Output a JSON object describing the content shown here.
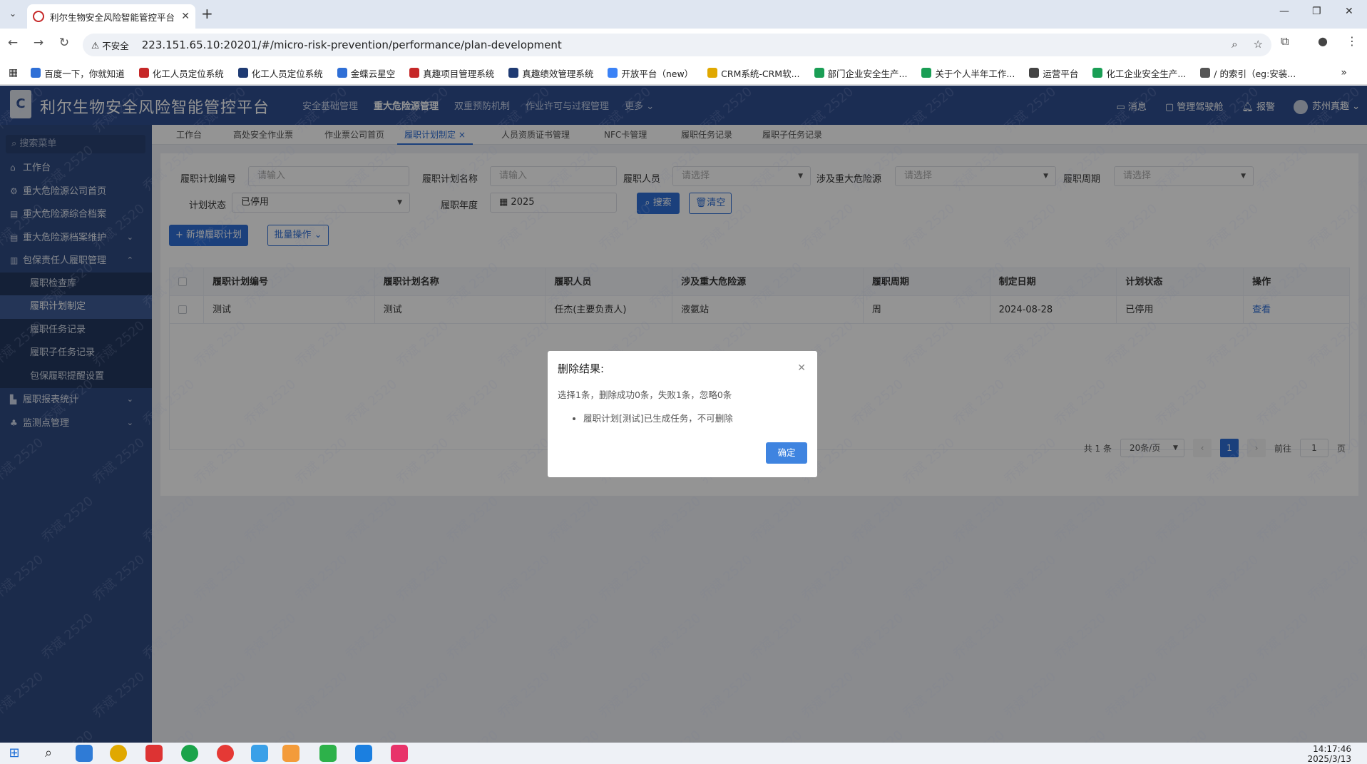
{
  "browser": {
    "tab_title": "利尔生物安全风险智能管控平台",
    "security_label": "不安全",
    "url": "223.151.65.10:20201/#/micro-risk-prevention/performance/plan-development",
    "bookmarks": [
      {
        "label": "百度一下，你就知道",
        "color": "#2f6fd6"
      },
      {
        "label": "化工人员定位系统",
        "color": "#c62828"
      },
      {
        "label": "化工人员定位系统",
        "color": "#1f3b73"
      },
      {
        "label": "金蝶云星空",
        "color": "#2f6fd6"
      },
      {
        "label": "真趣项目管理系统",
        "color": "#c62828"
      },
      {
        "label": "真趣绩效管理系统",
        "color": "#1f3b73"
      },
      {
        "label": "开放平台（new）",
        "color": "#3b82f6"
      },
      {
        "label": "CRM系统-CRM软...",
        "color": "#e0a800"
      },
      {
        "label": "部门企业安全生产...",
        "color": "#1a9e55"
      },
      {
        "label": "关于个人半年工作...",
        "color": "#1a9e55"
      },
      {
        "label": "运营平台",
        "color": "#444"
      },
      {
        "label": "化工企业安全生产...",
        "color": "#1a9e55"
      },
      {
        "label": "/ 的索引（eg:安装...",
        "color": "#555"
      }
    ]
  },
  "app": {
    "title": "利尔生物安全风险智能管控平台",
    "logo_text": "C",
    "top_nav": [
      "安全基础管理",
      "重大危险源管理",
      "双重预防机制",
      "作业许可与过程管理",
      "更多 ⌄"
    ],
    "top_nav_active": 1,
    "header_right": {
      "messages": "消息",
      "admin": "管理驾驶舱",
      "alarm": "报警",
      "user": "苏州真趣 ⌄"
    }
  },
  "sidebar": {
    "search_placeholder": "搜索菜单",
    "items": [
      {
        "label": "工作台",
        "icon": "⌂",
        "arrow": ""
      },
      {
        "label": "重大危险源公司首页",
        "icon": "⚙",
        "arrow": ""
      },
      {
        "label": "重大危险源综合档案",
        "icon": "▤",
        "arrow": ""
      },
      {
        "label": "重大危险源档案维护",
        "icon": "▤",
        "arrow": "⌄"
      },
      {
        "label": "包保责任人履职管理",
        "icon": "▥",
        "arrow": "⌃"
      }
    ],
    "sub_items": [
      "履职检查库",
      "履职计划制定",
      "履职任务记录",
      "履职子任务记录",
      "包保履职提醒设置"
    ],
    "sub_active": 1,
    "items_after": [
      {
        "label": "履职报表统计",
        "icon": "▙",
        "arrow": "⌄"
      },
      {
        "label": "监测点管理",
        "icon": "♣",
        "arrow": "⌄"
      }
    ]
  },
  "tags": [
    "工作台",
    "高处安全作业票",
    "作业票公司首页",
    "履职计划制定 ×",
    "人员资质证书管理",
    "NFC卡管理",
    "履职任务记录",
    "履职子任务记录"
  ],
  "filters": {
    "plan_no_label": "履职计划编号",
    "plan_no_placeholder": "请输入",
    "plan_name_label": "履职计划名称",
    "plan_name_placeholder": "请输入",
    "person_label": "履职人员",
    "person_placeholder": "请选择",
    "hazard_label": "涉及重大危险源",
    "hazard_placeholder": "请选择",
    "cycle_label": "履职周期",
    "cycle_placeholder": "请选择",
    "status_label": "计划状态",
    "status_value": "已停用",
    "year_label": "履职年度",
    "year_value": "2025",
    "search_button": "搜索",
    "clear_button": "清空"
  },
  "actions": {
    "add_button": "+ 新增履职计划",
    "batch_button": "批量操作 ⌄"
  },
  "table": {
    "headers": [
      "履职计划编号",
      "履职计划名称",
      "履职人员",
      "涉及重大危险源",
      "履职周期",
      "制定日期",
      "计划状态",
      "操作"
    ],
    "rows": [
      [
        "测试",
        "测试",
        "任杰(主要负责人)",
        "液氨站",
        "周",
        "2024-08-28",
        "已停用",
        "查看"
      ]
    ]
  },
  "pagination": {
    "total": "共 1 条",
    "page_size": "20条/页",
    "current": "1",
    "goto_label": "前往",
    "goto_value": "1",
    "page_unit": "页"
  },
  "dialog": {
    "title": "删除结果:",
    "message": "选择1条，删除成功0条，失败1条，忽略0条",
    "details": [
      "履职计划[测试]已生成任务，不可删除"
    ],
    "ok_button": "确定"
  },
  "taskbar": {
    "time": "14:17:46",
    "date": "2025/3/13"
  },
  "watermark": "乔斌 2520"
}
